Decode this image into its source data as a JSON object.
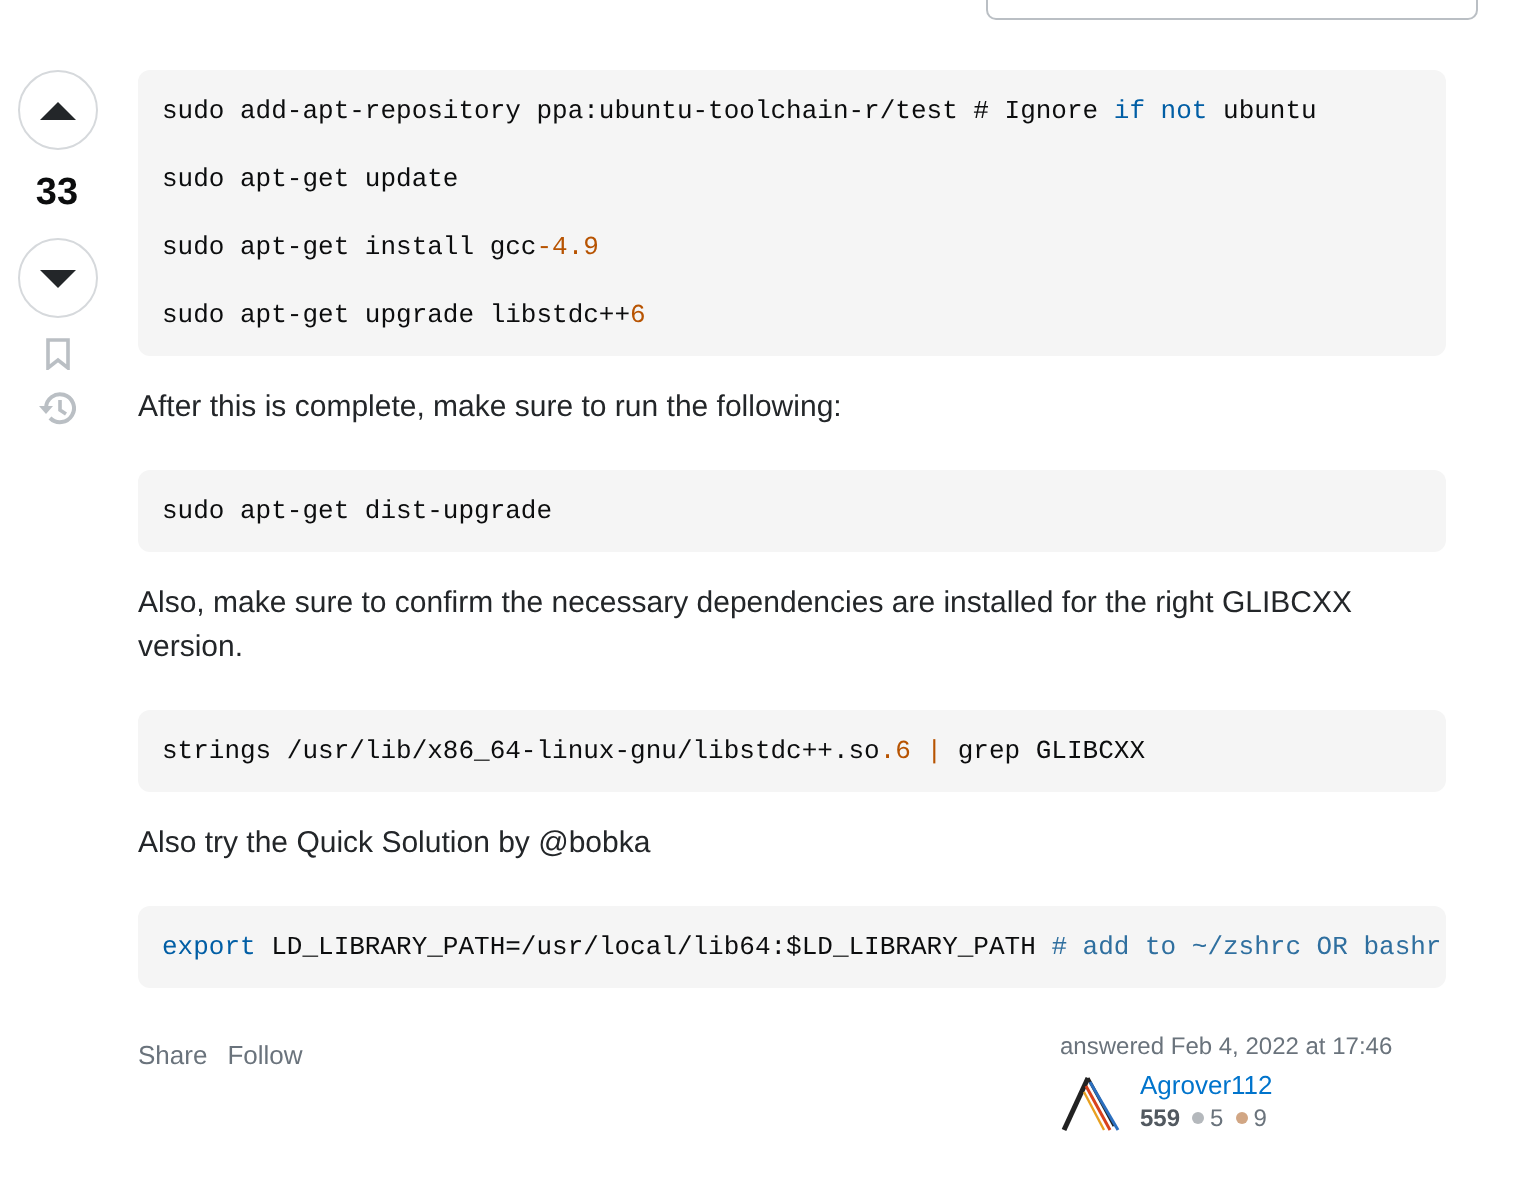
{
  "vote": {
    "count": "33"
  },
  "blocks": [
    {
      "kind": "code",
      "lines": [
        [
          {
            "kind": "plain",
            "text": "sudo add-apt-repository ppa:ubuntu-toolchain-r/test # Ignore "
          },
          {
            "kind": "keyword",
            "text": "if"
          },
          {
            "kind": "keyword",
            "text": " not"
          },
          {
            "kind": "plain",
            "text": " ubuntu"
          }
        ],
        [
          {
            "kind": "plain",
            "text": "sudo apt-get update"
          }
        ],
        [
          {
            "kind": "plain",
            "text": "sudo apt-get install gcc"
          },
          {
            "kind": "number",
            "text": "-4.9"
          }
        ],
        [
          {
            "kind": "plain",
            "text": "sudo apt-get upgrade libstdc++"
          },
          {
            "kind": "number",
            "text": "6"
          }
        ]
      ]
    },
    {
      "kind": "text",
      "text": "After this is complete, make sure to run the following:"
    },
    {
      "kind": "code",
      "lines": [
        [
          {
            "kind": "plain",
            "text": "sudo apt-get dist-upgrade"
          }
        ]
      ]
    },
    {
      "kind": "text",
      "text": "Also, make sure to confirm the necessary dependencies are installed for the right GLIBCXX version."
    },
    {
      "kind": "code",
      "lines": [
        [
          {
            "kind": "plain",
            "text": "strings /usr/lib/x86_64-linux-gnu/libstdc++.so"
          },
          {
            "kind": "number",
            "text": ".6"
          },
          {
            "kind": "number",
            "text": " |"
          },
          {
            "kind": "plain",
            "text": " grep GLIBCXX"
          }
        ]
      ]
    },
    {
      "kind": "text",
      "text": "Also try the Quick Solution by @bobka"
    },
    {
      "kind": "code",
      "lines": [
        [
          {
            "kind": "keyword",
            "text": "export"
          },
          {
            "kind": "plain",
            "text": " LD_LIBRARY_PATH=/usr/local/lib64:$LD_LIBRARY_PATH "
          },
          {
            "kind": "comment",
            "text": "# add to ~/zshrc OR bashr"
          }
        ]
      ]
    }
  ],
  "actions": [
    "Share",
    "Follow"
  ],
  "author": {
    "action": "answered Feb 4, 2022 at 17:46",
    "name": "Agrover112",
    "reputation": "559",
    "badges": [
      {
        "count": "5",
        "color": "#b4b8bc"
      },
      {
        "count": "9",
        "color": "#d1a684"
      }
    ]
  }
}
